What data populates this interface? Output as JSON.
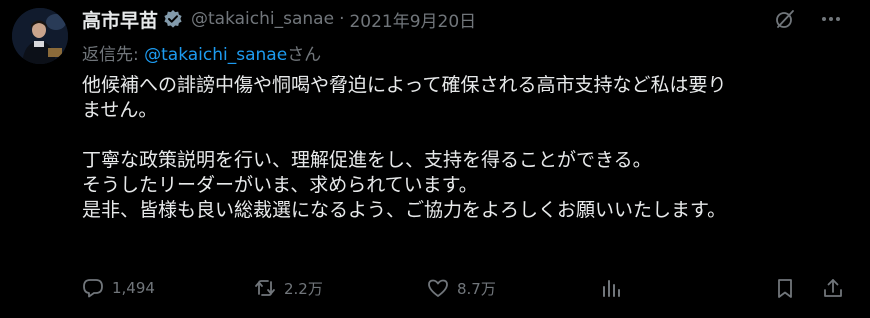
{
  "tweet": {
    "display_name": "高市早苗",
    "handle": "@takaichi_sanae",
    "separator": "·",
    "date": "2021年9月20日",
    "reply_prefix": "返信先: ",
    "reply_mention": "@takaichi_sanae",
    "reply_suffix": "さん",
    "body": {
      "para1_line1": "他候補への誹謗中傷や恫喝や脅迫によって確保される高市支持など私は要り",
      "para1_line2": "ません。",
      "para2_line1": "丁寧な政策説明を行い、理解促進をし、支持を得ることができる。",
      "para2_line2": "そうしたリーダーがいま、求められています。",
      "para2_line3": "是非、皆様も良い総裁選になるよう、ご協力をよろしくお願いいたします。"
    },
    "stats": {
      "replies": "1,494",
      "retweets": "2.2万",
      "likes": "8.7万"
    }
  },
  "icons": {
    "verified": "verified-badge-icon",
    "grok": "grok-icon",
    "more": "more-icon",
    "reply": "reply-icon",
    "retweet": "retweet-icon",
    "like": "like-icon",
    "views": "views-icon",
    "bookmark": "bookmark-icon",
    "share": "share-icon"
  },
  "colors": {
    "background": "#000000",
    "text": "#e7e9ea",
    "muted": "#71767b",
    "link": "#1d9bf0",
    "badge": "#829aab"
  }
}
